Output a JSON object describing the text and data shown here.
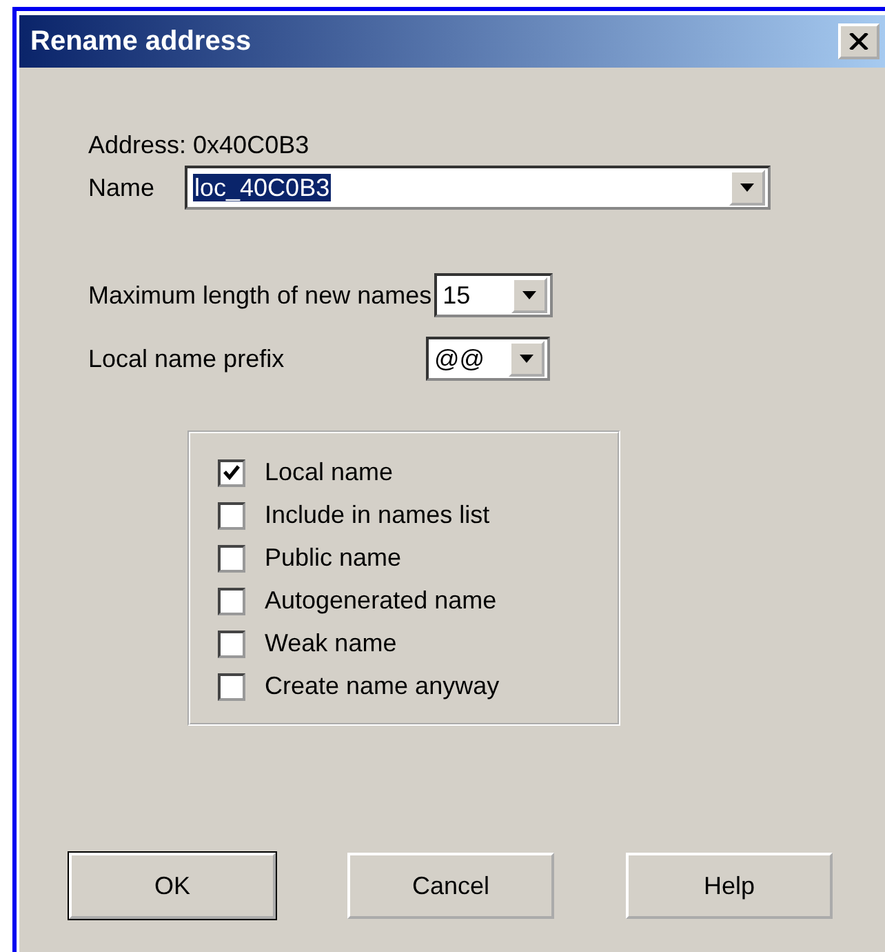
{
  "window": {
    "title": "Rename address"
  },
  "address": "Address: 0x40C0B3",
  "name_field": {
    "label": "Name",
    "value": "loc_40C0B3"
  },
  "max_length": {
    "label": "Maximum length of new names",
    "value": "15"
  },
  "prefix": {
    "label": "Local name prefix",
    "value": "@@"
  },
  "options": [
    {
      "label": "Local name",
      "checked": true
    },
    {
      "label": "Include in names list",
      "checked": false
    },
    {
      "label": "Public name",
      "checked": false
    },
    {
      "label": "Autogenerated name",
      "checked": false
    },
    {
      "label": "Weak name",
      "checked": false
    },
    {
      "label": "Create name anyway",
      "checked": false
    }
  ],
  "buttons": [
    {
      "label": "OK",
      "default": true
    },
    {
      "label": "Cancel",
      "default": false
    },
    {
      "label": "Help",
      "default": false
    }
  ]
}
